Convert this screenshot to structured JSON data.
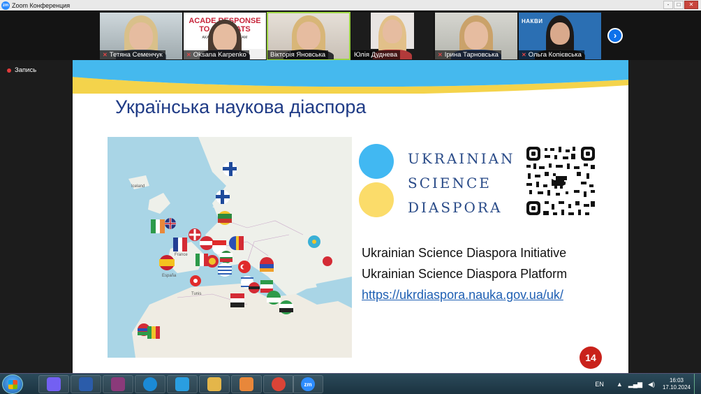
{
  "window": {
    "app_icon": "zm",
    "title": "Zoom Конференция",
    "controls": [
      "-",
      "□",
      "✕"
    ]
  },
  "participants": [
    {
      "name": "Тетяна Семенчук",
      "muted": true
    },
    {
      "name": "Oksana Karpenko",
      "muted": true,
      "poster_line1": "ACADE RESPONSE",
      "poster_line2": "TO HU REATS",
      "poster_small": "АКАДЕМІ ИМ ЗАГРОЗАМ"
    },
    {
      "name": "Вікторія Яновська",
      "muted": false,
      "active": true
    },
    {
      "name": "Юлія Дуднева",
      "muted": false
    },
    {
      "name": "Ірина Тарновська",
      "muted": true
    },
    {
      "name": "Ольга Копієвська",
      "muted": true,
      "bg_text": "НАКВИ"
    }
  ],
  "next_page_icon": "chevron-right-icon",
  "record": {
    "label": "Запись"
  },
  "slide": {
    "title": "Українська наукова діаспора",
    "logo_lines": [
      "UKRAINIAN",
      "SCIENCE",
      "DIASPORA"
    ],
    "info_lines": [
      "Ukrainian Science Diaspora Initiative",
      "Ukrainian Science Diaspora Platform"
    ],
    "link": "https://ukrdiaspora.nauka.gov.ua/uk/",
    "page_number": "14",
    "map_labels": [
      "Iceland",
      "France",
      "España",
      "Tunis"
    ]
  },
  "taskbar": {
    "apps": [
      {
        "name": "viber-icon",
        "color": "#7360f2"
      },
      {
        "name": "word-icon",
        "color": "#2b5caa"
      },
      {
        "name": "winrar-icon",
        "color": "#8a3a7a"
      },
      {
        "name": "edge-icon",
        "color": "#1b8ad6"
      },
      {
        "name": "ie-icon",
        "color": "#2a9ee0"
      },
      {
        "name": "explorer-icon",
        "color": "#e4b64a"
      },
      {
        "name": "media-player-icon",
        "color": "#e8873a"
      },
      {
        "name": "chrome-icon",
        "color": "#db4437"
      },
      {
        "name": "zoom-icon",
        "color": "#2d8cff"
      }
    ],
    "lang": "EN",
    "time": "16:03",
    "date": "17.10.2024"
  }
}
